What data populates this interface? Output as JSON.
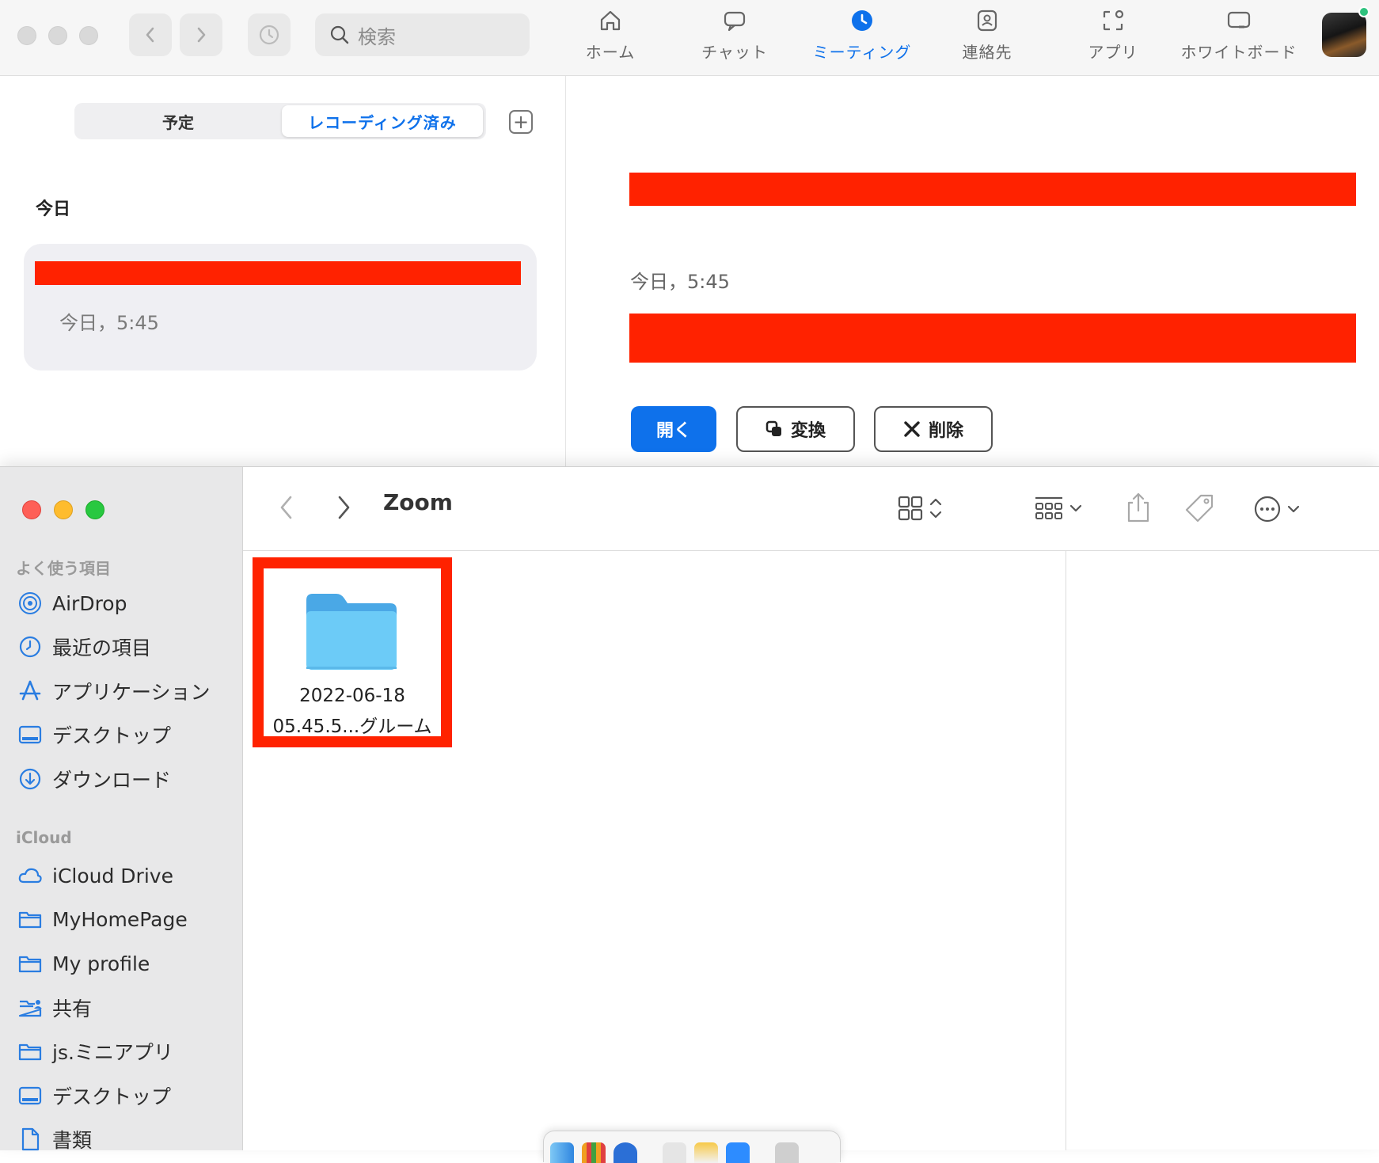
{
  "zoom": {
    "search_placeholder": "検索",
    "tabs": [
      {
        "label": "ホーム",
        "icon": "home-icon"
      },
      {
        "label": "チャット",
        "icon": "chat-icon"
      },
      {
        "label": "ミーティング",
        "icon": "clock-icon",
        "active": true
      },
      {
        "label": "連絡先",
        "icon": "contacts-icon"
      },
      {
        "label": "アプリ",
        "icon": "apps-icon"
      },
      {
        "label": "ホワイトボード",
        "icon": "whiteboard-icon"
      }
    ],
    "segments": {
      "scheduled": "予定",
      "recorded": "レコーディング済み"
    },
    "section_today": "今日",
    "recording": {
      "time": "今日，5:45"
    },
    "detail": {
      "time": "今日，5:45",
      "open_button": "開く",
      "convert_button": "変換",
      "delete_button": "削除"
    },
    "accent_color": "#0e71eb",
    "redaction_color": "#ff2200"
  },
  "finder": {
    "title": "Zoom",
    "favorites_header": "よく使う項目",
    "favorites": [
      {
        "label": "AirDrop",
        "icon": "airdrop-icon"
      },
      {
        "label": "最近の項目",
        "icon": "clock-icon"
      },
      {
        "label": "アプリケーション",
        "icon": "applications-icon"
      },
      {
        "label": "デスクトップ",
        "icon": "desktop-icon"
      },
      {
        "label": "ダウンロード",
        "icon": "download-icon"
      }
    ],
    "icloud_header": "iCloud",
    "icloud": [
      {
        "label": "iCloud Drive",
        "icon": "cloud-icon"
      },
      {
        "label": "MyHomePage",
        "icon": "folder-icon"
      },
      {
        "label": "My profile",
        "icon": "folder-icon"
      },
      {
        "label": "共有",
        "icon": "shared-folder-icon"
      },
      {
        "label": "js.ミニアプリ",
        "icon": "folder-icon"
      },
      {
        "label": "デスクトップ",
        "icon": "desktop-icon"
      },
      {
        "label": "書類",
        "icon": "document-icon"
      }
    ],
    "folder": {
      "name_line1": "2022-06-18",
      "name_line2": "05.45.5...グルーム"
    }
  }
}
